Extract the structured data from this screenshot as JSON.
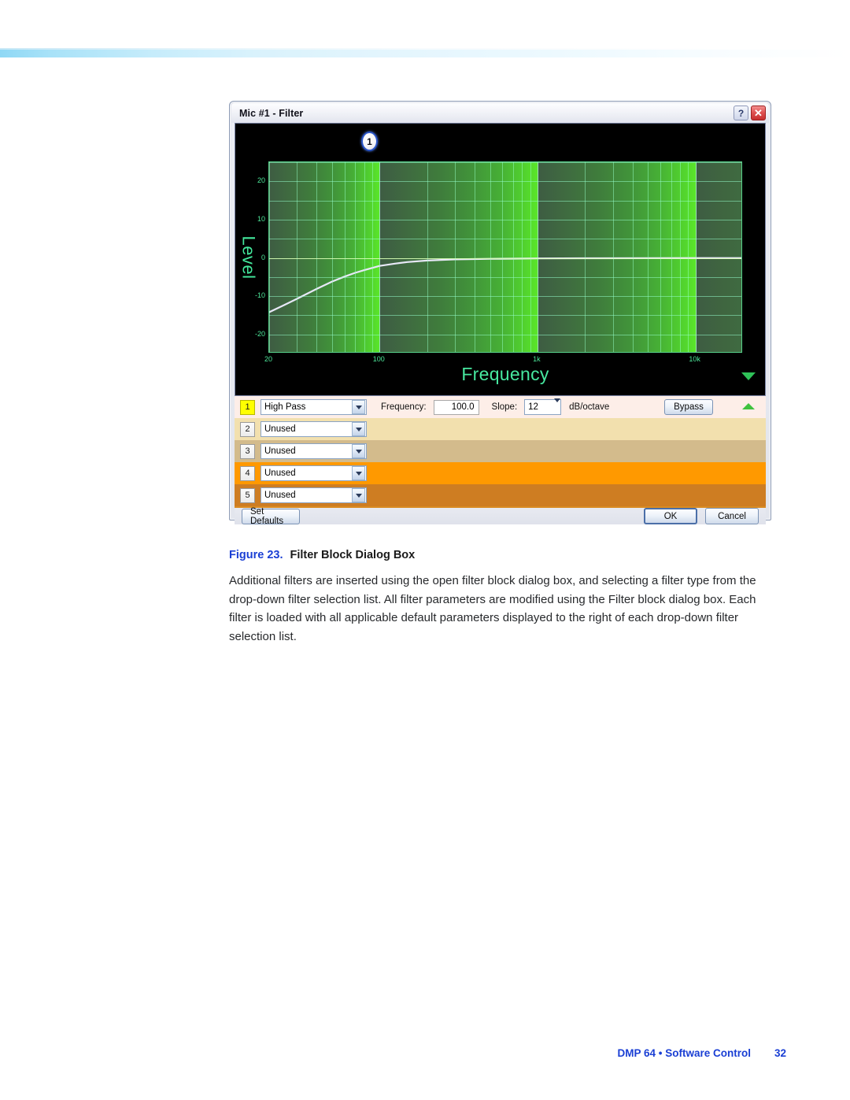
{
  "page": {
    "footer_title": "DMP 64 • Software Control",
    "page_number": "32"
  },
  "figure": {
    "number": "Figure 23.",
    "title": "Filter Block Dialog Box"
  },
  "body_text": "Additional filters are inserted using the open filter block dialog box, and selecting a filter type from the drop-down filter selection list. All filter parameters are modified using the Filter block dialog box. Each filter is loaded with all applicable default parameters displayed to the right of each drop-down filter selection list.",
  "dialog": {
    "title": "Mic #1 - Filter",
    "titlebar_buttons": [
      {
        "name": "help-button",
        "glyph": "?"
      },
      {
        "name": "close-button",
        "glyph": "✕"
      }
    ],
    "graph": {
      "badge_label": "1",
      "scroll_down_icon": "triangle-down-icon"
    },
    "filters": [
      {
        "index": "1",
        "type": "High Pass",
        "active": true,
        "frequency_label": "Frequency:",
        "frequency_value": "100.0",
        "slope_label": "Slope:",
        "slope_value": "12",
        "unit_label": "dB/octave",
        "bypass_label": "Bypass",
        "band_color": "#fdeee8"
      },
      {
        "index": "2",
        "type": "Unused",
        "active": false,
        "band_color": "#f2e0ae"
      },
      {
        "index": "3",
        "type": "Unused",
        "active": false,
        "band_color": "#d3bb8c"
      },
      {
        "index": "4",
        "type": "Unused",
        "active": false,
        "band_color": "#ff9900"
      },
      {
        "index": "5",
        "type": "Unused",
        "active": false,
        "band_color": "#ce7d22"
      }
    ],
    "buttons": {
      "set_defaults": "Set Defaults",
      "ok": "OK",
      "cancel": "Cancel"
    }
  },
  "chart_data": {
    "type": "line",
    "title": "",
    "xlabel": "Frequency",
    "ylabel": "Level",
    "xscale": "log",
    "xlim": [
      20,
      20000
    ],
    "ylim": [
      -25,
      25
    ],
    "xticks": [
      20,
      100,
      1000,
      10000
    ],
    "xtick_labels": [
      "20",
      "100",
      "1k",
      "10k"
    ],
    "yticks": [
      20,
      10,
      0,
      -10,
      -20
    ],
    "ytick_labels": [
      "20",
      "10",
      "0",
      "-10",
      "-20"
    ],
    "grid": true,
    "legend": "none",
    "series": [
      {
        "name": "High Pass 100.0 Hz, 12 dB/octave",
        "x": [
          20,
          25,
          30,
          40,
          50,
          60,
          70,
          80,
          100,
          125,
          150,
          200,
          300,
          400,
          500,
          700,
          1000,
          2000,
          5000,
          10000,
          20000
        ],
        "y": [
          -14.2,
          -12.3,
          -10.7,
          -8.1,
          -6.2,
          -4.9,
          -3.9,
          -3.2,
          -2.1,
          -1.5,
          -1.1,
          -0.7,
          -0.4,
          -0.3,
          -0.25,
          -0.2,
          -0.15,
          -0.1,
          -0.08,
          -0.05,
          -0.05
        ],
        "color": "#e8e8f8"
      }
    ],
    "background_bands": {
      "description": "log-decade green gradient bands",
      "dark": "#3e5c43",
      "bright": "#5ae62a"
    }
  },
  "colors": {
    "accent_blue": "#1a3fd4",
    "banner_blue": "#8fd8f5",
    "active_row_highlight": "#ffff00",
    "graph_axis_green": "#4de89a"
  }
}
